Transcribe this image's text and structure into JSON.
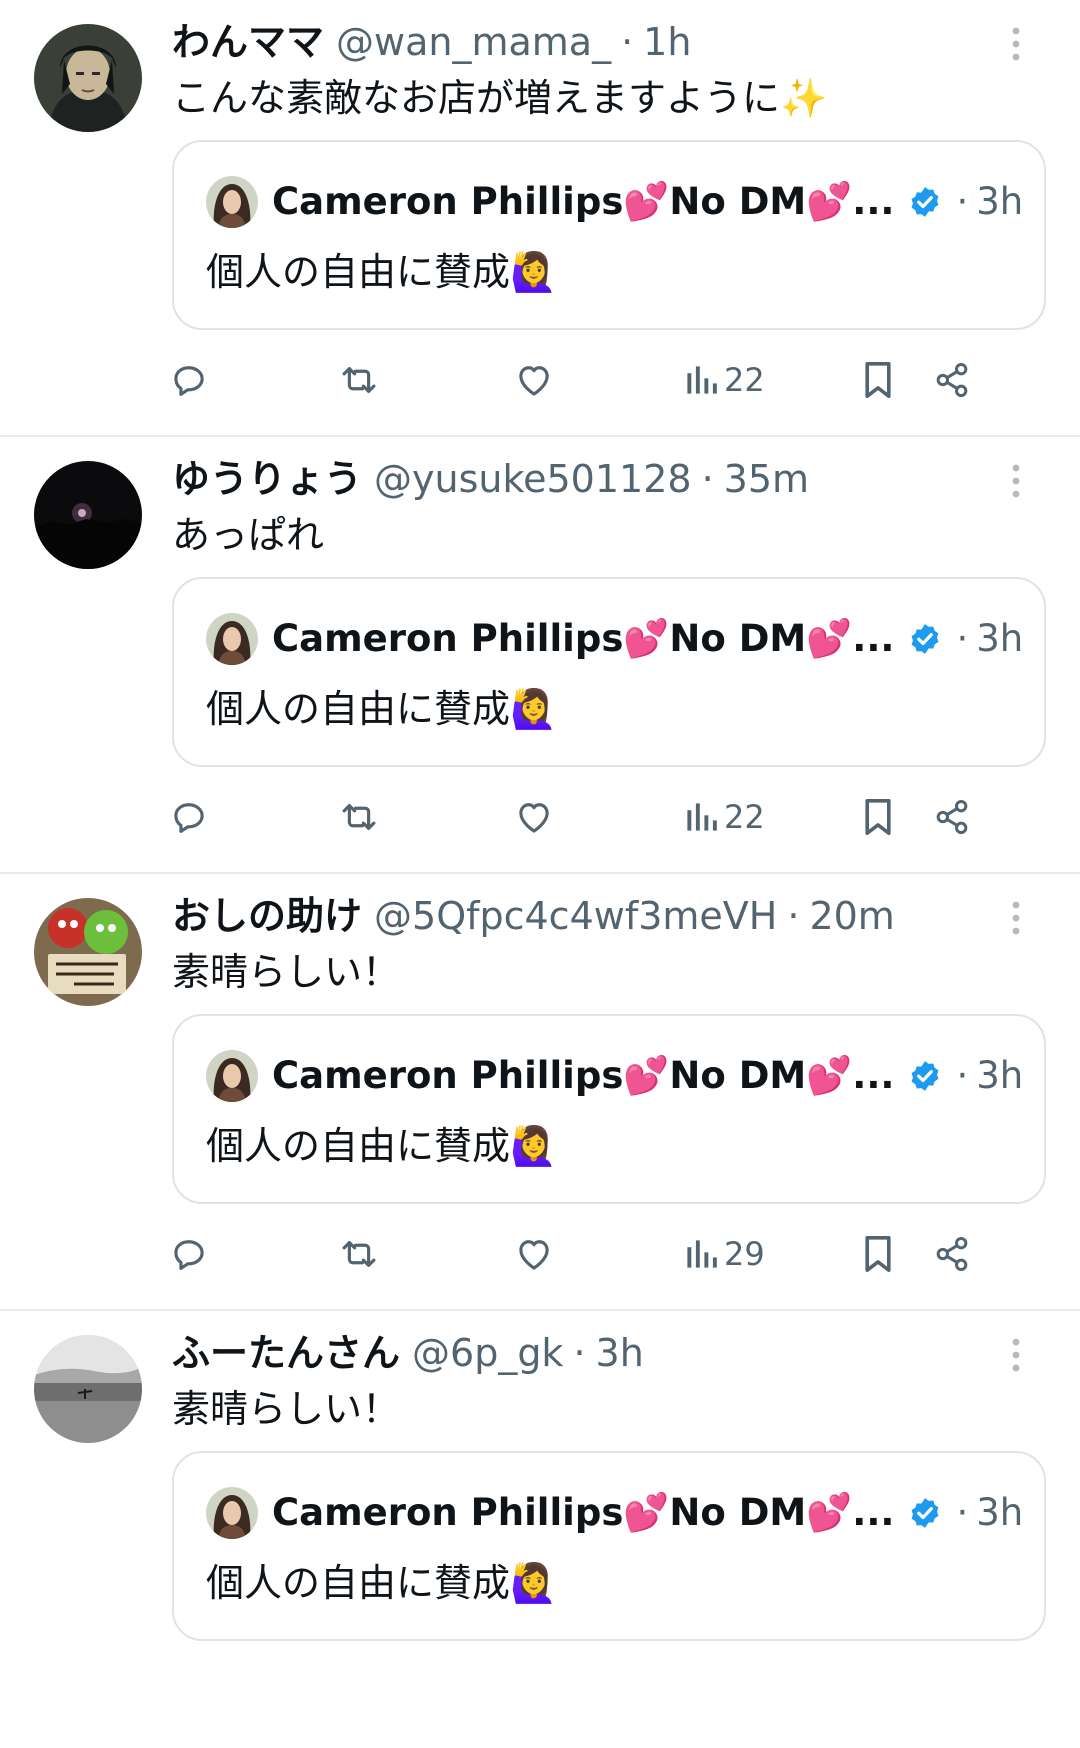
{
  "feed": {
    "accent_color": "#1d9bf0",
    "muted_color": "#536471",
    "tweets": [
      {
        "display_name": "わんママ",
        "handle": "@wan_mama_",
        "separator": "·",
        "time": "1h",
        "text": "こんな素敵なお店が増えますように✨",
        "avatar_icon": "anime-character-avatar",
        "quote": {
          "display_name": "Cameron Phillips💕No DM💕...",
          "verified_icon": "verified-badge-icon",
          "separator": "·",
          "time": "3h",
          "text": "個人の自由に賛成🙋‍♀️"
        },
        "actions": {
          "reply_icon": "reply-icon",
          "retweet_icon": "retweet-icon",
          "like_icon": "like-icon",
          "views_icon": "views-icon",
          "views": "22",
          "bookmark_icon": "bookmark-icon",
          "share_icon": "share-icon"
        }
      },
      {
        "display_name": "ゆうりょう",
        "handle": "@yusuke501128",
        "separator": "·",
        "time": "35m",
        "text": "あっぱれ",
        "avatar_icon": "night-sky-avatar",
        "quote": {
          "display_name": "Cameron Phillips💕No DM💕...",
          "verified_icon": "verified-badge-icon",
          "separator": "·",
          "time": "3h",
          "text": "個人の自由に賛成🙋‍♀️"
        },
        "actions": {
          "reply_icon": "reply-icon",
          "retweet_icon": "retweet-icon",
          "like_icon": "like-icon",
          "views_icon": "views-icon",
          "views": "22",
          "bookmark_icon": "bookmark-icon",
          "share_icon": "share-icon"
        }
      },
      {
        "display_name": "おしの助け",
        "handle": "@5Qfpc4c4wf3meVH",
        "separator": "·",
        "time": "20m",
        "text": "素晴らしい！",
        "avatar_icon": "mascot-characters-avatar",
        "quote": {
          "display_name": "Cameron Phillips💕No DM💕...",
          "verified_icon": "verified-badge-icon",
          "separator": "·",
          "time": "3h",
          "text": "個人の自由に賛成🙋‍♀️"
        },
        "actions": {
          "reply_icon": "reply-icon",
          "retweet_icon": "retweet-icon",
          "like_icon": "like-icon",
          "views_icon": "views-icon",
          "views": "29",
          "bookmark_icon": "bookmark-icon",
          "share_icon": "share-icon"
        }
      },
      {
        "display_name": "ふーたんさん",
        "handle": "@6p_gk",
        "separator": "·",
        "time": "3h",
        "text": "素晴らしい！",
        "avatar_icon": "beach-surfer-avatar",
        "quote": {
          "display_name": "Cameron Phillips💕No DM💕...",
          "verified_icon": "verified-badge-icon",
          "separator": "·",
          "time": "3h",
          "text": "個人の自由に賛成🙋‍♀️"
        }
      }
    ]
  }
}
